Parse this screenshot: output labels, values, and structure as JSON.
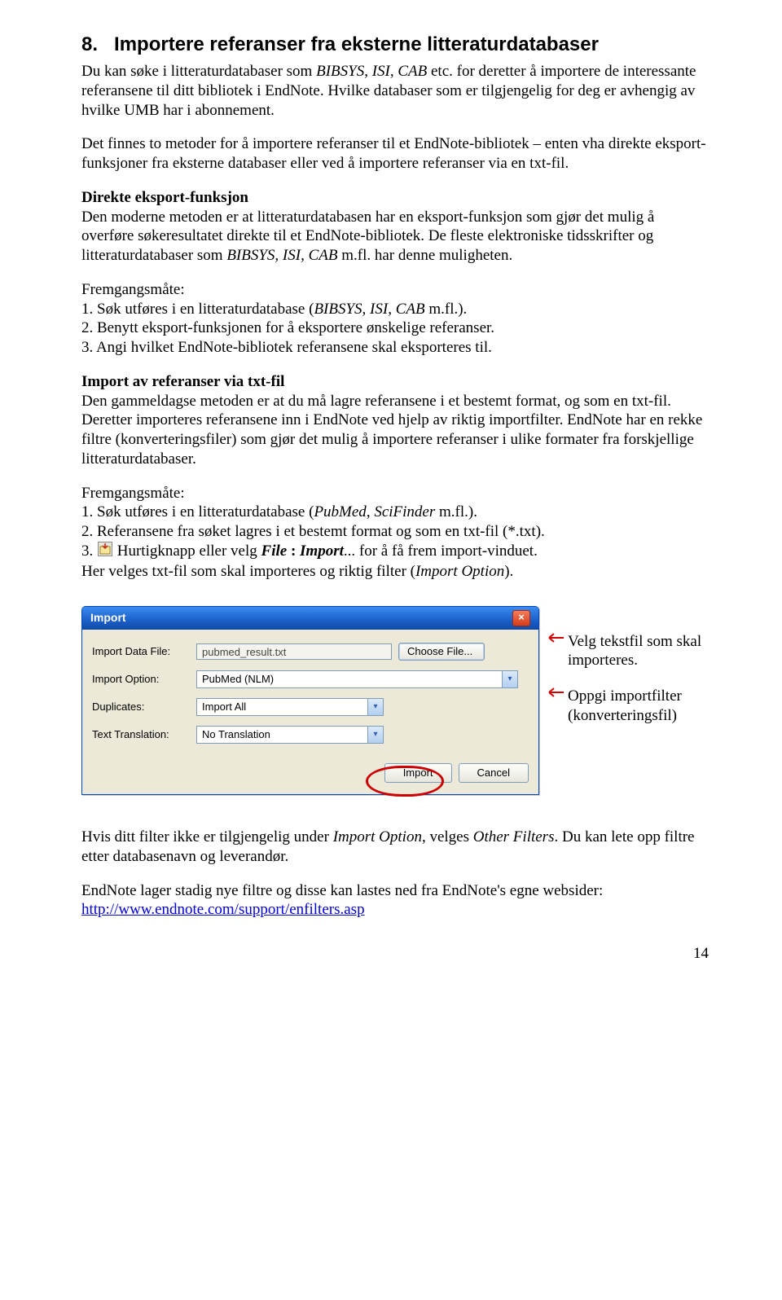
{
  "heading_prefix": "8.",
  "heading": "Importere referanser fra eksterne litteraturdatabaser",
  "intro1a": "Du kan søke i litteraturdatabaser som ",
  "intro1b": "BIBSYS",
  "intro1c": ", ",
  "intro1d": "ISI",
  "intro1e": ", ",
  "intro1f": "CAB",
  "intro1g": " etc. for deretter å importere de interessante referansene til ditt bibliotek i EndNote. Hvilke databaser som er tilgjengelig for deg er avhengig av hvilke UMB har i abonnement.",
  "intro2": "Det finnes to metoder for å importere referanser til et EndNote-bibliotek – enten vha direkte eksport-funksjoner fra eksterne databaser eller ved å importere referanser via en txt-fil.",
  "sec1_title": "Direkte eksport-funksjon",
  "sec1_p1": "Den moderne metoden er at litteraturdatabasen har en eksport-funksjon som gjør det mulig å overføre søkeresultatet direkte til et EndNote-bibliotek. De fleste elektroniske tidsskrifter og litteraturdatabaser som ",
  "sec1_p1_it": "BIBSYS, ISI, CAB",
  "sec1_p1b": " m.fl. har denne muligheten.",
  "fremg": "Fremgangsmåte:",
  "sec1_s1a": "1. Søk utføres i en litteraturdatabase (",
  "sec1_s1b": "BIBSYS, ISI, CAB",
  "sec1_s1c": " m.fl.).",
  "sec1_s2": "2. Benytt eksport-funksjonen for å eksportere ønskelige referanser.",
  "sec1_s3": "3. Angi hvilket EndNote-bibliotek referansene skal eksporteres til.",
  "sec2_title": "Import av referanser via txt-fil",
  "sec2_p": "Den gammeldagse metoden er at du må lagre referansene i et bestemt format, og som en txt-fil. Deretter importeres referansene inn i EndNote ved hjelp av riktig importfilter. EndNote har en rekke filtre (konverteringsfiler) som gjør det mulig å importere referanser i ulike formater fra forskjellige litteraturdatabaser.",
  "sec2_s1a": "1. Søk utføres i en litteraturdatabase (",
  "sec2_s1b": "PubMed",
  "sec2_s1c": ", ",
  "sec2_s1d": "SciFinder",
  "sec2_s1e": " m.fl.).",
  "sec2_s2": "2. Referansene fra søket lagres i et bestemt format og som en txt-fil (*.txt).",
  "sec2_s3a": "3. ",
  "sec2_s3b": " Hurtigknapp eller velg ",
  "sec2_s3c": "File",
  "sec2_s3d": " : ",
  "sec2_s3e": "Import",
  "sec2_s3f": "... for å få frem import-vinduet.",
  "sec2_s4a": "Her velges txt-fil som skal importeres og riktig filter (",
  "sec2_s4b": "Import Option",
  "sec2_s4c": ").",
  "dialog": {
    "title": "Import",
    "close": "×",
    "lbl_file": "Import Data File:",
    "val_file": "pubmed_result.txt",
    "choose": "Choose File...",
    "lbl_option": "Import Option:",
    "val_option": "PubMed (NLM)",
    "lbl_dup": "Duplicates:",
    "val_dup": "Import All",
    "lbl_trans": "Text Translation:",
    "val_trans": "No Translation",
    "btn_import": "Import",
    "btn_cancel": "Cancel"
  },
  "anno1": "Velg tekstfil som skal importeres.",
  "anno2": "Oppgi importfilter (konverteringsfil)",
  "closing1a": "Hvis ditt filter ikke er tilgjengelig under ",
  "closing1b": "Import Option",
  "closing1c": ", velges ",
  "closing1d": "Other Filters",
  "closing1e": ". Du kan lete opp filtre etter databasenavn og leverandør.",
  "closing2": "EndNote lager stadig nye filtre og disse kan lastes ned fra EndNote's egne websider:",
  "link": "http://www.endnote.com/support/enfilters.asp",
  "page": "14"
}
